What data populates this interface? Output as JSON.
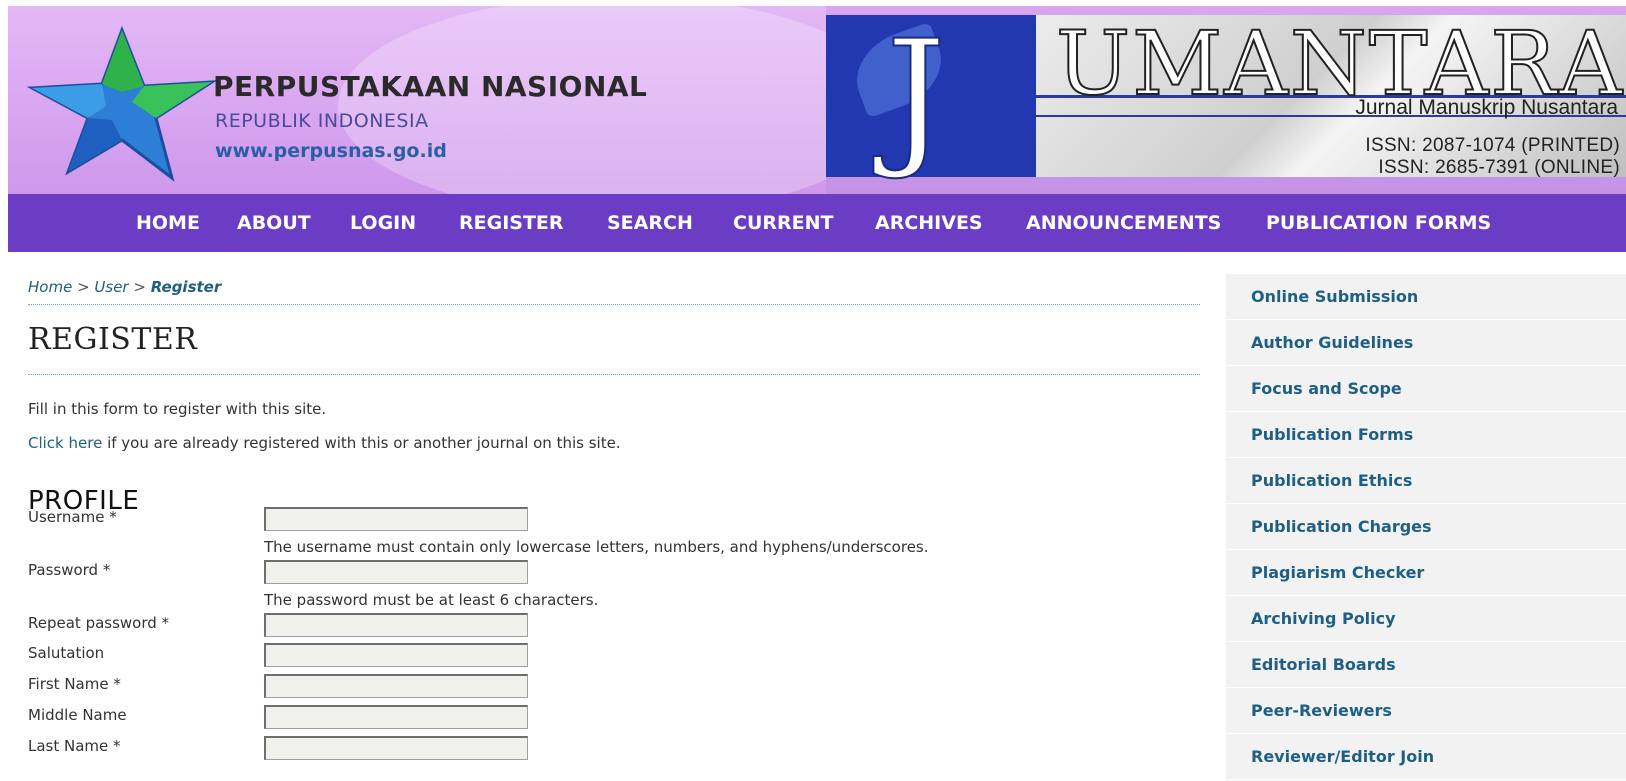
{
  "header": {
    "library_name": "PERPUSTAKAAN NASIONAL",
    "library_sub": "REPUBLIK INDONESIA",
    "library_url": "www.perpusnas.go.id",
    "journal_big_letter": "J",
    "journal_name_rest": "UMANTARA",
    "journal_subtitle": "Jurnal Manuskrip Nusantara",
    "issn_printed": "ISSN: 2087-1074 (PRINTED)",
    "issn_online": "ISSN: 2685-7391 (ONLINE)"
  },
  "nav": {
    "items": [
      {
        "label": "HOME"
      },
      {
        "label": "ABOUT"
      },
      {
        "label": "LOGIN"
      },
      {
        "label": "REGISTER"
      },
      {
        "label": "SEARCH"
      },
      {
        "label": "CURRENT"
      },
      {
        "label": "ARCHIVES"
      },
      {
        "label": "ANNOUNCEMENTS"
      },
      {
        "label": "PUBLICATION FORMS"
      }
    ]
  },
  "breadcrumb": {
    "home": "Home",
    "sep": " > ",
    "user": "User",
    "current": "Register"
  },
  "page": {
    "title": "REGISTER",
    "intro": "Fill in this form to register with this site.",
    "click_here": "Click here",
    "intro2_rest": " if you are already registered with this or another journal on this site."
  },
  "profile": {
    "section_title": "PROFILE",
    "username_label": "Username *",
    "username_help": "The username must contain only lowercase letters, numbers, and hyphens/underscores.",
    "password_label": "Password *",
    "password_help": "The password must be at least 6 characters.",
    "repeat_password_label": "Repeat password *",
    "salutation_label": "Salutation",
    "first_name_label": "First Name *",
    "middle_name_label": "Middle Name",
    "last_name_label": "Last Name *"
  },
  "sidebar": {
    "items": [
      {
        "label": "Online Submission"
      },
      {
        "label": "Author Guidelines"
      },
      {
        "label": "Focus and Scope"
      },
      {
        "label": "Publication Forms"
      },
      {
        "label": "Publication Ethics"
      },
      {
        "label": "Publication Charges"
      },
      {
        "label": "Plagiarism Checker"
      },
      {
        "label": "Archiving Policy"
      },
      {
        "label": "Editorial Boards"
      },
      {
        "label": "Peer-Reviewers"
      },
      {
        "label": "Reviewer/Editor Join"
      }
    ]
  },
  "colors": {
    "nav_bg": "#6b3cc4",
    "banner_bg": "#d9a6f1",
    "link": "#1f5f86",
    "sidebar_bg": "#f2f2f2"
  }
}
